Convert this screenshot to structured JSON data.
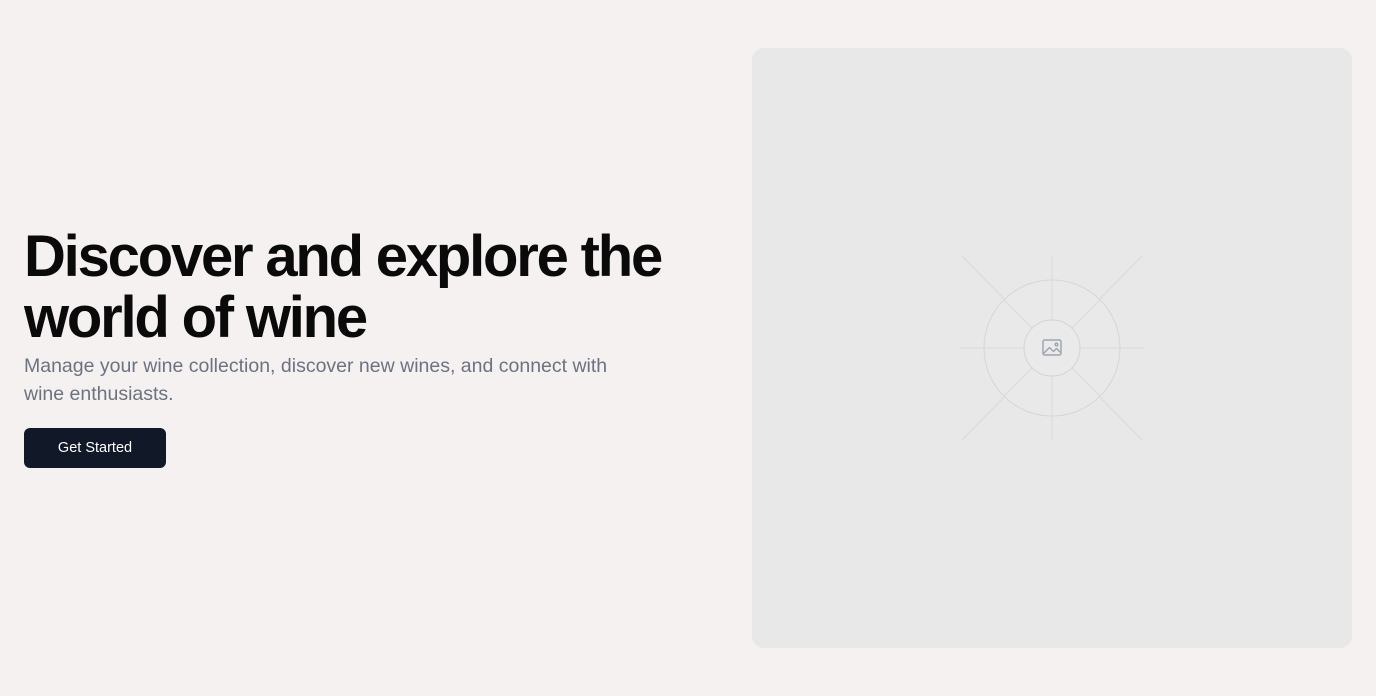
{
  "hero": {
    "title": "Discover and explore the world of wine",
    "subtitle": "Manage your wine collection, discover new wines, and connect with wine enthusiasts.",
    "cta_label": "Get Started"
  },
  "media": {
    "icon": "image-icon"
  },
  "colors": {
    "background": "#f6f1f1",
    "button": "#111827",
    "placeholder": "#e8e8e8",
    "subtitle": "#6b7280"
  }
}
